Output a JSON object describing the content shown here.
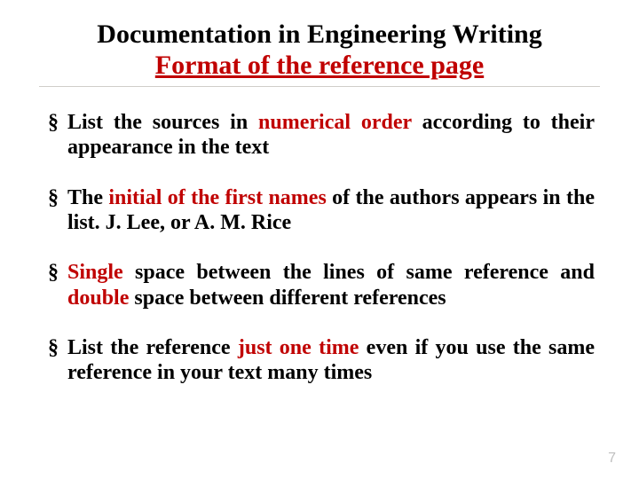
{
  "title": {
    "line1": "Documentation in Engineering Writing",
    "line2": "Format of the reference page"
  },
  "bullets": [
    {
      "pre": "List the sources in ",
      "em": "numerical order",
      "post": " according to their appearance in the text"
    },
    {
      "pre": "The ",
      "em": "initial of the first names",
      "post": " of the authors appears in the list. J. Lee, or A. M. Rice"
    },
    {
      "em1": "Single",
      "mid1": " space between the lines of same reference and ",
      "em2": "double",
      "mid2": " space between different references"
    },
    {
      "pre": "List the reference ",
      "em": "just one time",
      "post": " even if you use the same reference in your text many times"
    }
  ],
  "page_number": "7"
}
